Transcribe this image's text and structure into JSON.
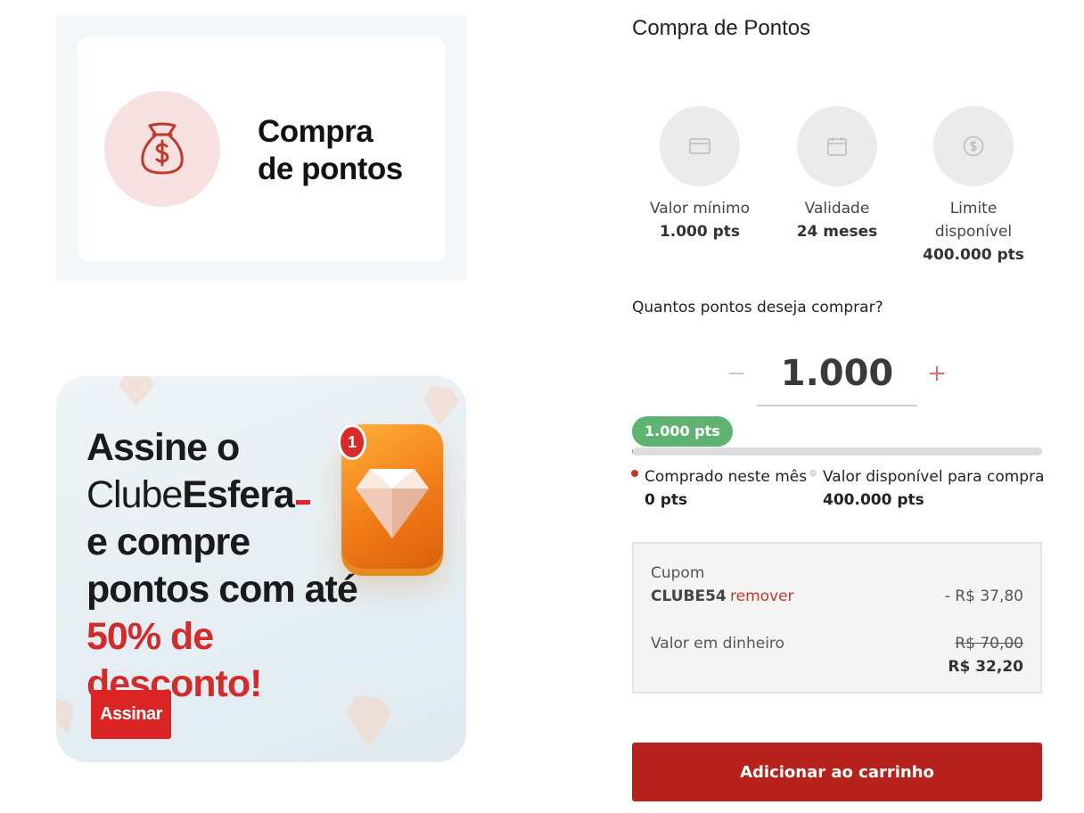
{
  "left_card": {
    "title": "Compra\nde pontos",
    "icon": "money-bag-icon",
    "accent": "#c0392b"
  },
  "promo": {
    "line1": "Assine o",
    "line2_light": "Clube",
    "line2_bold": "Esfera",
    "line3": "e compre",
    "line4": "pontos com até",
    "line5": "50% de desconto!",
    "notification_count": "1",
    "button_label": "Assinar",
    "icon": "diamond-icon"
  },
  "panel": {
    "title": "Compra de Pontos",
    "info": [
      {
        "icon": "card-icon",
        "label": "Valor mínimo",
        "value": "1.000 pts"
      },
      {
        "icon": "calendar-icon",
        "label": "Validade",
        "value": "24 meses"
      },
      {
        "icon": "dollar-icon",
        "label": "Limite disponível",
        "value": "400.000 pts"
      }
    ],
    "question": "Quantos pontos deseja comprar?",
    "stepper": {
      "minus": "−",
      "plus": "+",
      "value": "1.000"
    },
    "progress": {
      "pill": "1.000 pts",
      "fraction": 0.003
    },
    "legend": [
      {
        "label": "Comprado neste mês",
        "value": "0 pts",
        "color": "#c0392b"
      },
      {
        "label": "Valor disponível para compra",
        "value": "400.000 pts",
        "color": "#dcdcdc"
      }
    ],
    "coupon": {
      "label": "Cupom",
      "code": "CLUBE54",
      "remove": "remover",
      "discount": "- R$ 37,80",
      "cash_label": "Valor em dinheiro",
      "old_price": "R$ 70,00",
      "new_price": "R$ 32,20"
    },
    "add_button": "Adicionar ao carrinho"
  },
  "colors": {
    "brand_red": "#b8221c",
    "progress_green": "#5fb370"
  }
}
